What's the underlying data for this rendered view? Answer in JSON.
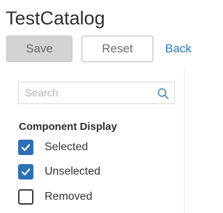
{
  "page": {
    "title": "TestCatalog"
  },
  "toolbar": {
    "save_label": "Save",
    "reset_label": "Reset",
    "back_label": "Back"
  },
  "search": {
    "placeholder": "Search",
    "value": "",
    "icon": "search-icon"
  },
  "component_display": {
    "title": "Component Display",
    "options": [
      {
        "label": "Selected",
        "checked": true
      },
      {
        "label": "Unselected",
        "checked": true
      },
      {
        "label": "Removed",
        "checked": false
      }
    ]
  },
  "colors": {
    "accent": "#2c6fb4",
    "link": "#2a7ab8",
    "disabled_button": "#d3d3d3"
  }
}
